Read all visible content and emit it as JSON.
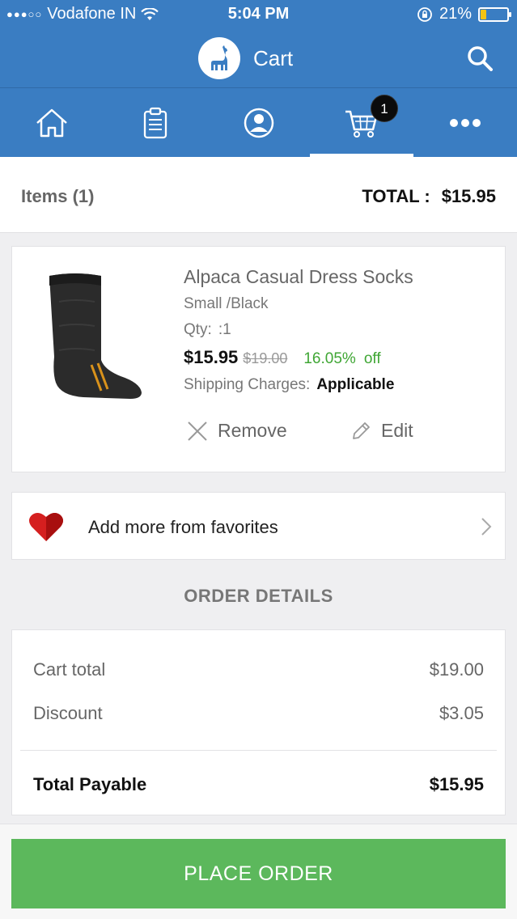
{
  "status_bar": {
    "carrier": "Vodafone IN",
    "time": "5:04 PM",
    "battery": "21%",
    "battery_level": 0.21
  },
  "header": {
    "title": "Cart",
    "logo_icon": "alpaca-icon",
    "search_icon": "search-icon"
  },
  "tabs": [
    {
      "name": "home",
      "icon": "home-icon"
    },
    {
      "name": "orders",
      "icon": "clipboard-icon"
    },
    {
      "name": "account",
      "icon": "user-icon"
    },
    {
      "name": "cart",
      "icon": "cart-icon",
      "badge": "1",
      "active": true
    },
    {
      "name": "more",
      "icon": "more-icon"
    }
  ],
  "summary": {
    "items_label": "Items (1)",
    "total_label": "TOTAL :",
    "total_value": "$15.95"
  },
  "product": {
    "name": "Alpaca Casual Dress Socks",
    "variant": "Small /Black",
    "qty_label": "Qty:",
    "qty_value": ":1",
    "price_now": "$15.95",
    "price_old": "$19.00",
    "discount_pct": "16.05%",
    "discount_suffix": "off",
    "shipping_label": "Shipping Charges:",
    "shipping_value": "Applicable",
    "remove_label": "Remove",
    "edit_label": "Edit"
  },
  "favorites": {
    "label": "Add more from favorites"
  },
  "order_details": {
    "heading": "ORDER DETAILS",
    "cart_total_label": "Cart total",
    "cart_total_value": "$19.00",
    "discount_label": "Discount",
    "discount_value": "$3.05",
    "payable_label": "Total Payable",
    "payable_value": "$15.95"
  },
  "place_order": "PLACE ORDER",
  "colors": {
    "primary": "#3a7dc2",
    "success": "#5cb85c",
    "discount": "#3fa634"
  }
}
